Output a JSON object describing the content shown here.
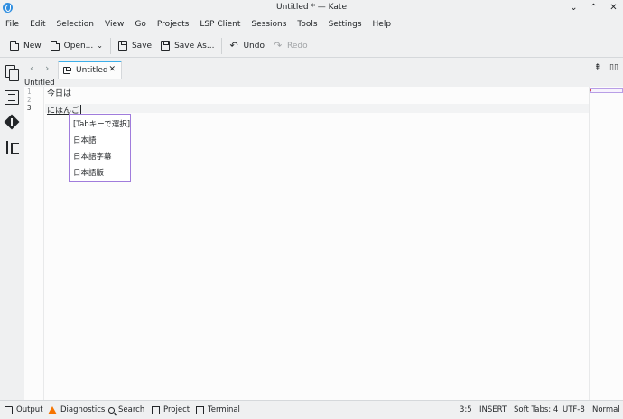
{
  "window": {
    "title": "Untitled * — Kate"
  },
  "menu": [
    "File",
    "Edit",
    "Selection",
    "View",
    "Go",
    "Projects",
    "LSP Client",
    "Sessions",
    "Tools",
    "Settings",
    "Help"
  ],
  "toolbar": {
    "new_label": "New",
    "open_label": "Open...",
    "save_label": "Save",
    "save_as_label": "Save As...",
    "undo_label": "Undo",
    "redo_label": "Redo"
  },
  "tab": {
    "label": "Untitled"
  },
  "document": {
    "name": "Untitled",
    "line_numbers": [
      "1",
      "2",
      "3"
    ],
    "lines": [
      "今日は",
      "",
      "にほんご"
    ]
  },
  "completion": {
    "items": [
      "[Tabキーで選択]",
      "日本語",
      "日本語字幕",
      "日本語版"
    ]
  },
  "statusbar": {
    "output": "Output",
    "diagnostics": "Diagnostics",
    "search": "Search",
    "project": "Project",
    "terminal": "Terminal",
    "cursor": "3:5",
    "mode": "INSERT",
    "indent": "Soft Tabs: 4",
    "encoding": "UTF-8",
    "syntax": "Normal"
  },
  "colors": {
    "accent": "#3daee9",
    "popup_border": "#a07cdc",
    "warning": "#f67400"
  }
}
